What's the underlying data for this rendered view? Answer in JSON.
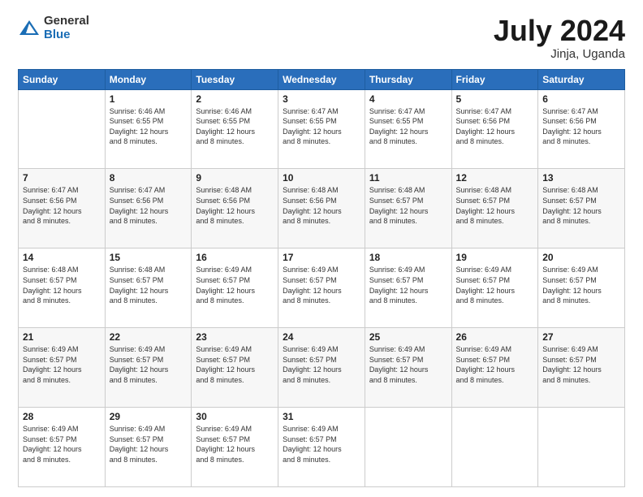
{
  "logo": {
    "general": "General",
    "blue": "Blue"
  },
  "title": "July 2024",
  "location": "Jinja, Uganda",
  "days_of_week": [
    "Sunday",
    "Monday",
    "Tuesday",
    "Wednesday",
    "Thursday",
    "Friday",
    "Saturday"
  ],
  "weeks": [
    [
      {
        "day": "",
        "info": ""
      },
      {
        "day": "1",
        "info": "Sunrise: 6:46 AM\nSunset: 6:55 PM\nDaylight: 12 hours\nand 8 minutes."
      },
      {
        "day": "2",
        "info": "Sunrise: 6:46 AM\nSunset: 6:55 PM\nDaylight: 12 hours\nand 8 minutes."
      },
      {
        "day": "3",
        "info": "Sunrise: 6:47 AM\nSunset: 6:55 PM\nDaylight: 12 hours\nand 8 minutes."
      },
      {
        "day": "4",
        "info": "Sunrise: 6:47 AM\nSunset: 6:55 PM\nDaylight: 12 hours\nand 8 minutes."
      },
      {
        "day": "5",
        "info": "Sunrise: 6:47 AM\nSunset: 6:56 PM\nDaylight: 12 hours\nand 8 minutes."
      },
      {
        "day": "6",
        "info": "Sunrise: 6:47 AM\nSunset: 6:56 PM\nDaylight: 12 hours\nand 8 minutes."
      }
    ],
    [
      {
        "day": "7",
        "info": "Sunrise: 6:47 AM\nSunset: 6:56 PM\nDaylight: 12 hours\nand 8 minutes."
      },
      {
        "day": "8",
        "info": "Sunrise: 6:47 AM\nSunset: 6:56 PM\nDaylight: 12 hours\nand 8 minutes."
      },
      {
        "day": "9",
        "info": "Sunrise: 6:48 AM\nSunset: 6:56 PM\nDaylight: 12 hours\nand 8 minutes."
      },
      {
        "day": "10",
        "info": "Sunrise: 6:48 AM\nSunset: 6:56 PM\nDaylight: 12 hours\nand 8 minutes."
      },
      {
        "day": "11",
        "info": "Sunrise: 6:48 AM\nSunset: 6:57 PM\nDaylight: 12 hours\nand 8 minutes."
      },
      {
        "day": "12",
        "info": "Sunrise: 6:48 AM\nSunset: 6:57 PM\nDaylight: 12 hours\nand 8 minutes."
      },
      {
        "day": "13",
        "info": "Sunrise: 6:48 AM\nSunset: 6:57 PM\nDaylight: 12 hours\nand 8 minutes."
      }
    ],
    [
      {
        "day": "14",
        "info": "Sunrise: 6:48 AM\nSunset: 6:57 PM\nDaylight: 12 hours\nand 8 minutes."
      },
      {
        "day": "15",
        "info": "Sunrise: 6:48 AM\nSunset: 6:57 PM\nDaylight: 12 hours\nand 8 minutes."
      },
      {
        "day": "16",
        "info": "Sunrise: 6:49 AM\nSunset: 6:57 PM\nDaylight: 12 hours\nand 8 minutes."
      },
      {
        "day": "17",
        "info": "Sunrise: 6:49 AM\nSunset: 6:57 PM\nDaylight: 12 hours\nand 8 minutes."
      },
      {
        "day": "18",
        "info": "Sunrise: 6:49 AM\nSunset: 6:57 PM\nDaylight: 12 hours\nand 8 minutes."
      },
      {
        "day": "19",
        "info": "Sunrise: 6:49 AM\nSunset: 6:57 PM\nDaylight: 12 hours\nand 8 minutes."
      },
      {
        "day": "20",
        "info": "Sunrise: 6:49 AM\nSunset: 6:57 PM\nDaylight: 12 hours\nand 8 minutes."
      }
    ],
    [
      {
        "day": "21",
        "info": "Sunrise: 6:49 AM\nSunset: 6:57 PM\nDaylight: 12 hours\nand 8 minutes."
      },
      {
        "day": "22",
        "info": "Sunrise: 6:49 AM\nSunset: 6:57 PM\nDaylight: 12 hours\nand 8 minutes."
      },
      {
        "day": "23",
        "info": "Sunrise: 6:49 AM\nSunset: 6:57 PM\nDaylight: 12 hours\nand 8 minutes."
      },
      {
        "day": "24",
        "info": "Sunrise: 6:49 AM\nSunset: 6:57 PM\nDaylight: 12 hours\nand 8 minutes."
      },
      {
        "day": "25",
        "info": "Sunrise: 6:49 AM\nSunset: 6:57 PM\nDaylight: 12 hours\nand 8 minutes."
      },
      {
        "day": "26",
        "info": "Sunrise: 6:49 AM\nSunset: 6:57 PM\nDaylight: 12 hours\nand 8 minutes."
      },
      {
        "day": "27",
        "info": "Sunrise: 6:49 AM\nSunset: 6:57 PM\nDaylight: 12 hours\nand 8 minutes."
      }
    ],
    [
      {
        "day": "28",
        "info": "Sunrise: 6:49 AM\nSunset: 6:57 PM\nDaylight: 12 hours\nand 8 minutes."
      },
      {
        "day": "29",
        "info": "Sunrise: 6:49 AM\nSunset: 6:57 PM\nDaylight: 12 hours\nand 8 minutes."
      },
      {
        "day": "30",
        "info": "Sunrise: 6:49 AM\nSunset: 6:57 PM\nDaylight: 12 hours\nand 8 minutes."
      },
      {
        "day": "31",
        "info": "Sunrise: 6:49 AM\nSunset: 6:57 PM\nDaylight: 12 hours\nand 8 minutes."
      },
      {
        "day": "",
        "info": ""
      },
      {
        "day": "",
        "info": ""
      },
      {
        "day": "",
        "info": ""
      }
    ]
  ]
}
